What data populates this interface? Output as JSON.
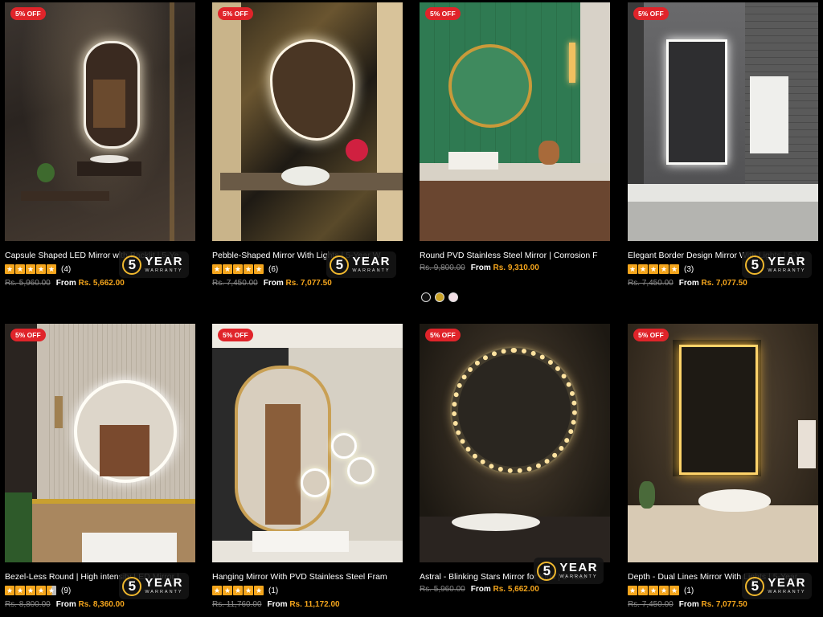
{
  "warranty": {
    "number": "5",
    "big": "YEAR",
    "small": "WARRANTY"
  },
  "products": [
    {
      "badge": "5% OFF",
      "title": "Capsule Shaped LED Mirror with Backlit | 5-Ye",
      "rating_count": "(4)",
      "old_price": "Rs. 5,960.00",
      "from": "From",
      "price": "Rs. 5,662.00",
      "stars": 5
    },
    {
      "badge": "5% OFF",
      "title": "Pebble-Shaped Mirror With Lights | 5-Year W",
      "rating_count": "(6)",
      "old_price": "Rs. 7,450.00",
      "from": "From",
      "price": "Rs. 7,077.50",
      "stars": 5
    },
    {
      "badge": "5% OFF",
      "title": "Round PVD Stainless Steel Mirror | Corrosion F",
      "rating_count": "",
      "old_price": "Rs. 9,800.00",
      "from": "From",
      "price": "Rs. 9,310.00",
      "stars": 0
    },
    {
      "badge": "5% OFF",
      "title": "Elegant Border Design Mirror With Lights | 5-Y",
      "rating_count": "(3)",
      "old_price": "Rs. 7,450.00",
      "from": "From",
      "price": "Rs. 7,077.50",
      "stars": 5
    },
    {
      "badge": "5% OFF",
      "title": "Bezel-Less Round | High intensity LED Mirror |",
      "rating_count": "(9)",
      "old_price": "Rs. 8,800.00",
      "from": "From",
      "price": "Rs. 8,360.00",
      "stars": 4.5
    },
    {
      "badge": "5% OFF",
      "title": "Hanging Mirror With PVD Stainless Steel Fram",
      "rating_count": "(1)",
      "old_price": "Rs. 11,760.00",
      "from": "From",
      "price": "Rs. 11,172.00",
      "stars": 5
    },
    {
      "badge": "5% OFF",
      "title": "Astral - Blinking Stars Mirror for Kids | 5-Year",
      "rating_count": "",
      "old_price": "Rs. 5,960.00",
      "from": "From",
      "price": "Rs. 5,662.00",
      "stars": 0
    },
    {
      "badge": "5% OFF",
      "title": "Depth - Dual Lines Mirror With Lights | 5-Year",
      "rating_count": "(1)",
      "old_price": "Rs. 7,450.00",
      "from": "From",
      "price": "Rs. 7,077.50",
      "stars": 5
    }
  ],
  "swatch_colors": [
    "#111111",
    "#c9a227",
    "#f2dde4"
  ],
  "colors": {
    "accent": "#f4a51c",
    "badge": "#e0242a",
    "warranty_ring": "#f0b82e"
  }
}
